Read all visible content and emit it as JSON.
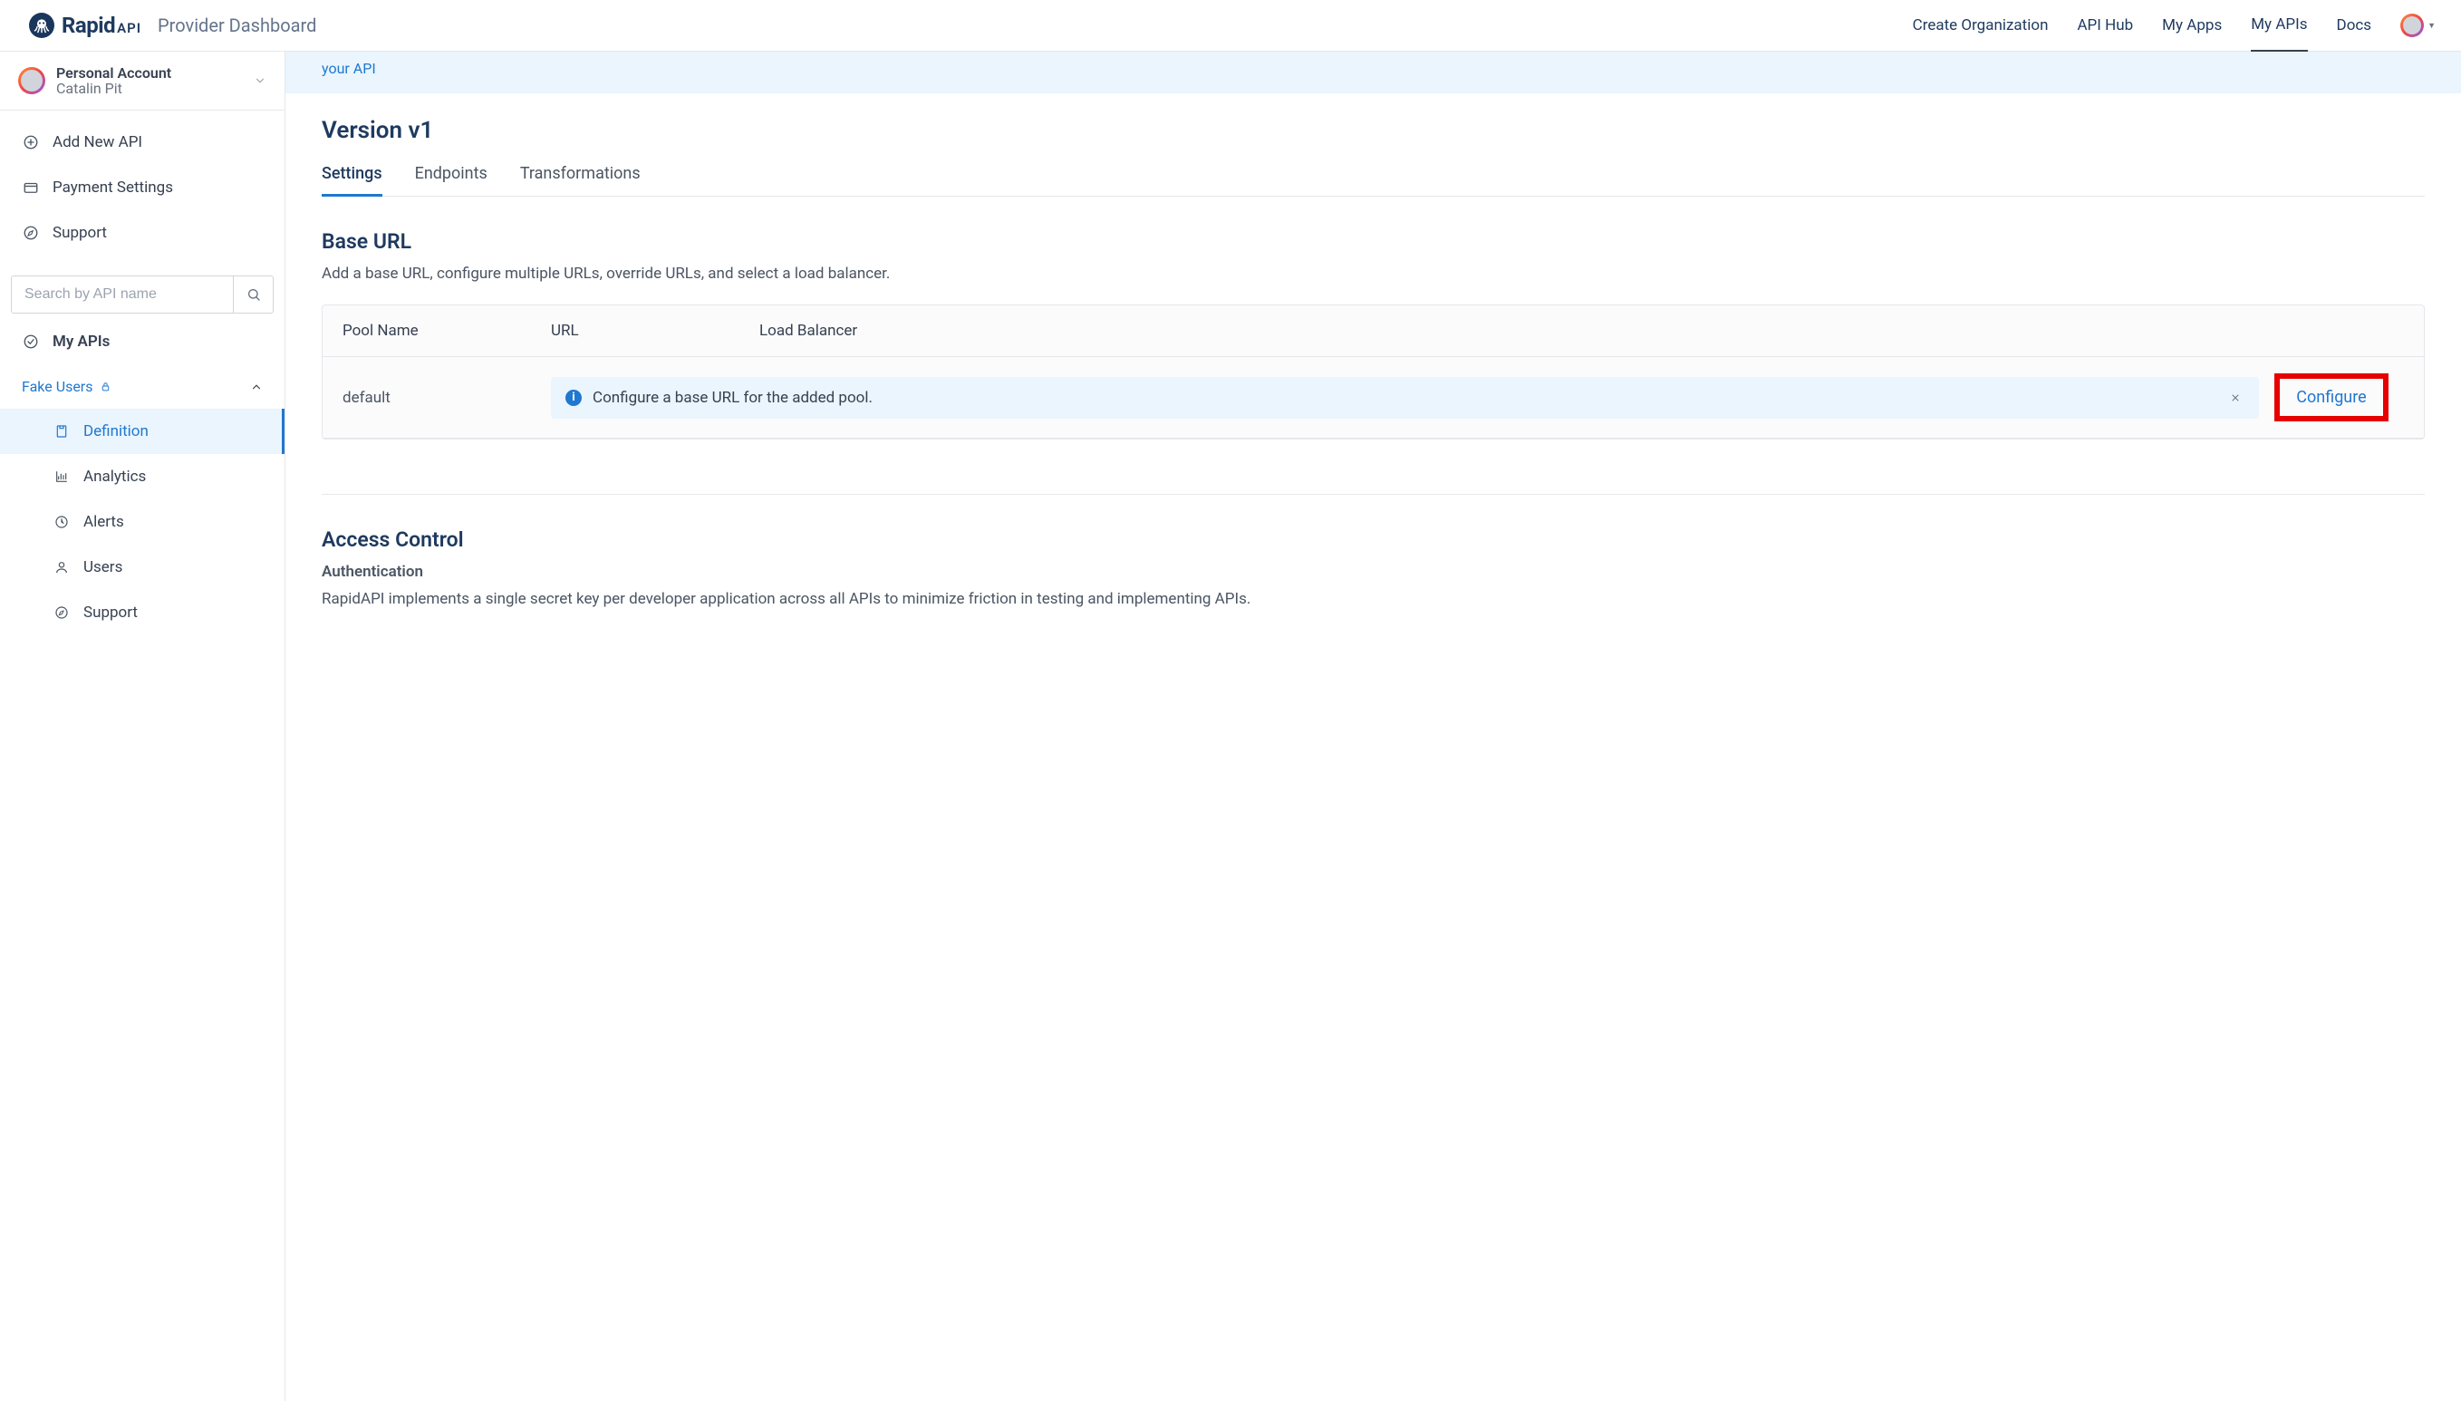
{
  "header": {
    "brand_main": "Rapid",
    "brand_sub": "API",
    "title": "Provider Dashboard",
    "nav": [
      {
        "label": "Create Organization",
        "active": false
      },
      {
        "label": "API Hub",
        "active": false
      },
      {
        "label": "My Apps",
        "active": false
      },
      {
        "label": "My APIs",
        "active": true
      },
      {
        "label": "Docs",
        "active": false
      }
    ]
  },
  "account": {
    "title": "Personal Account",
    "name": "Catalin Pit"
  },
  "sidebar": {
    "primary": [
      {
        "label": "Add New API",
        "icon": "plus-circle-icon"
      },
      {
        "label": "Payment Settings",
        "icon": "card-icon"
      },
      {
        "label": "Support",
        "icon": "compass-icon"
      }
    ],
    "search_placeholder": "Search by API name",
    "myapis_label": "My APIs",
    "api_name": "Fake Users",
    "api_items": [
      {
        "label": "Definition",
        "icon": "definition-icon",
        "active": true
      },
      {
        "label": "Analytics",
        "icon": "analytics-icon",
        "active": false
      },
      {
        "label": "Alerts",
        "icon": "clock-icon",
        "active": false
      },
      {
        "label": "Users",
        "icon": "user-icon",
        "active": false
      },
      {
        "label": "Support",
        "icon": "compass-icon",
        "active": false
      }
    ]
  },
  "banner_link": "your API",
  "main": {
    "version_title": "Version v1",
    "tabs": [
      {
        "label": "Settings",
        "active": true
      },
      {
        "label": "Endpoints",
        "active": false
      },
      {
        "label": "Transformations",
        "active": false
      }
    ],
    "baseurl": {
      "title": "Base URL",
      "desc": "Add a base URL, configure multiple URLs, override URLs, and select a load balancer.",
      "columns": [
        "Pool Name",
        "URL",
        "Load Balancer"
      ],
      "row": {
        "pool": "default",
        "alert": "Configure a base URL for the added pool.",
        "action": "Configure"
      }
    },
    "access": {
      "title": "Access Control",
      "auth_label": "Authentication",
      "auth_desc": "RapidAPI implements a single secret key per developer application across all APIs to minimize friction in testing and implementing APIs."
    }
  }
}
